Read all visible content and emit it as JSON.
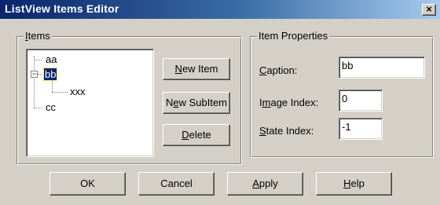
{
  "window": {
    "title": "ListView Items Editor",
    "close_glyph": "×"
  },
  "items_group": {
    "label_underlined": "I",
    "label_rest": "tems"
  },
  "tree": {
    "items": [
      {
        "label": "aa"
      },
      {
        "label": "bb",
        "expanded": true,
        "selected": true,
        "expander_glyph": "−",
        "children": [
          {
            "label": "xxx"
          }
        ]
      },
      {
        "label": "cc"
      }
    ]
  },
  "buttons": {
    "new_item": {
      "underlined": "N",
      "rest": "ew Item"
    },
    "new_subitem": {
      "before": "N",
      "underlined": "e",
      "rest": "w SubItem"
    },
    "delete": {
      "underlined": "D",
      "rest": "elete"
    }
  },
  "properties_group": {
    "label": "Item Properties",
    "caption": {
      "underlined": "C",
      "rest": "aption:",
      "value": "bb"
    },
    "image_index": {
      "before": "I",
      "underlined": "m",
      "rest": "age Index:",
      "value": "0"
    },
    "state_index": {
      "underlined": "S",
      "rest": "tate Index:",
      "value": "-1"
    }
  },
  "footer": {
    "ok": "OK",
    "cancel": "Cancel",
    "apply": {
      "underlined": "A",
      "rest": "pply"
    },
    "help": {
      "underlined": "H",
      "rest": "elp"
    }
  }
}
